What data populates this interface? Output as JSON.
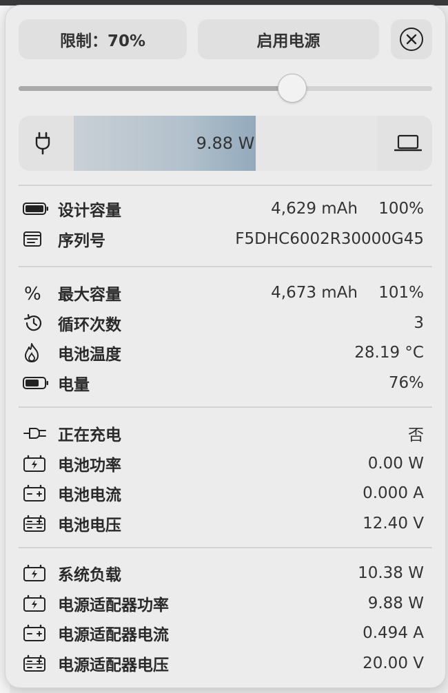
{
  "header": {
    "limit_label": "限制：70%",
    "enable_label": "启用电源"
  },
  "slider": {
    "value_fraction": 0.66
  },
  "power": {
    "value": "9.88 W",
    "fill_fraction": 0.6
  },
  "sections": [
    [
      {
        "icon": "battery-full-icon",
        "label": "设计容量",
        "value": "4,629 mAh",
        "percent": "100%"
      },
      {
        "icon": "serial-number-icon",
        "label": "序列号",
        "value": "F5DHC6002R30000G45",
        "percent": ""
      }
    ],
    [
      {
        "icon": "percent-icon",
        "label": "最大容量",
        "value": "4,673 mAh",
        "percent": "101%"
      },
      {
        "icon": "cycle-history-icon",
        "label": "循环次数",
        "value": "3",
        "percent": ""
      },
      {
        "icon": "flame-icon",
        "label": "电池温度",
        "value": "28.19 °C",
        "percent": ""
      },
      {
        "icon": "battery-level-icon",
        "label": "电量",
        "value": "76%",
        "percent": ""
      }
    ],
    [
      {
        "icon": "charging-plug-icon",
        "label": "正在充电",
        "value": "否",
        "percent": ""
      },
      {
        "icon": "battery-power-icon",
        "label": "电池功率",
        "value": "0.00 W",
        "percent": ""
      },
      {
        "icon": "battery-current-icon",
        "label": "电池电流",
        "value": "0.000 A",
        "percent": ""
      },
      {
        "icon": "battery-voltage-icon",
        "label": "电池电压",
        "value": "12.40 V",
        "percent": ""
      }
    ],
    [
      {
        "icon": "system-load-icon",
        "label": "系统负载",
        "value": "10.38 W",
        "percent": ""
      },
      {
        "icon": "adapter-power-icon",
        "label": "电源适配器功率",
        "value": "9.88 W",
        "percent": ""
      },
      {
        "icon": "adapter-current-icon",
        "label": "电源适配器电流",
        "value": "0.494 A",
        "percent": ""
      },
      {
        "icon": "adapter-voltage-icon",
        "label": "电源适配器电压",
        "value": "20.00 V",
        "percent": ""
      }
    ]
  ]
}
